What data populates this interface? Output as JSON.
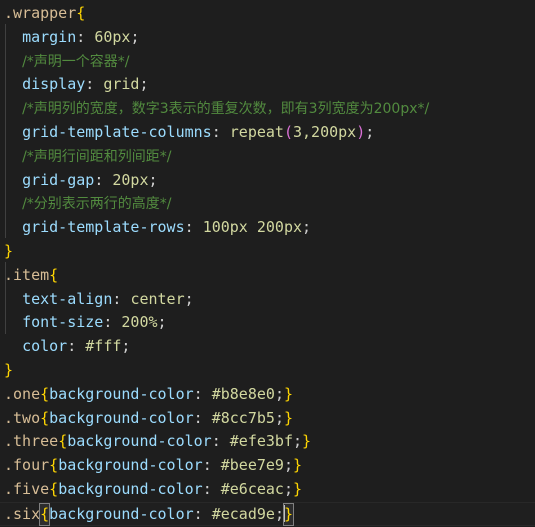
{
  "editor": {
    "theme": "dark-plus",
    "background_color": "#1e1e1e",
    "language": "css",
    "current_line_number": 21,
    "total_lines": 21,
    "colors": {
      "selector": "#d7bd96",
      "brace": "#ffd602",
      "property": "#9cdcfe",
      "value": "#d2d8a0",
      "paren": "#da70d6",
      "comment": "#528b3f",
      "plain": "#d4d4d4",
      "indent_guide": "#404040",
      "bracket_match_outline": "#808080"
    }
  },
  "code": {
    "l1": {
      "selector": ".wrapper",
      "brace": "{"
    },
    "l2": {
      "prop": "margin",
      "punct": ": ",
      "value": "60px",
      "semi": ";"
    },
    "l3": {
      "comment": "/*声明一个容器*/"
    },
    "l4": {
      "prop": "display",
      "punct": ": ",
      "value": "grid",
      "semi": ";"
    },
    "l5": {
      "comment": "/*声明列的宽度，数字3表示的重复次数，即有3列宽度为200px*/"
    },
    "l6": {
      "prop": "grid-template-columns",
      "punct": ": ",
      "func": "repeat",
      "paren_open": "(",
      "args": "3,200px",
      "paren_close": ")",
      "semi": ";"
    },
    "l7": {
      "comment": "/*声明行间距和列间距*/"
    },
    "l8": {
      "prop": "grid-gap",
      "punct": ": ",
      "value": "20px",
      "semi": ";"
    },
    "l9": {
      "comment": "/*分别表示两行的高度*/"
    },
    "l10": {
      "prop": "grid-template-rows",
      "punct": ": ",
      "value": "100px 200px",
      "semi": ";"
    },
    "l11": {
      "brace": "}"
    },
    "l12": {
      "selector": ".item",
      "brace": "{"
    },
    "l13": {
      "prop": "text-align",
      "punct": ": ",
      "value": "center",
      "semi": ";"
    },
    "l14": {
      "prop": "font-size",
      "punct": ": ",
      "value": "200%",
      "semi": ";"
    },
    "l15": {
      "prop": "color",
      "punct": ": ",
      "value": "#fff",
      "semi": ";"
    },
    "l16": {
      "brace": "}"
    },
    "l17": {
      "selector": ".one",
      "open": "{",
      "prop": "background-color",
      "punct": ": ",
      "value": "#b8e8e0",
      "semi": ";",
      "close": "}"
    },
    "l18": {
      "selector": ".two",
      "open": "{",
      "prop": "background-color",
      "punct": ": ",
      "value": "#8cc7b5",
      "semi": ";",
      "close": "}"
    },
    "l19": {
      "selector": ".three",
      "open": "{",
      "prop": "background-color",
      "punct": ": ",
      "value": "#efe3bf",
      "semi": ";",
      "close": "}"
    },
    "l20": {
      "selector": ".four",
      "open": "{",
      "prop": "background-color",
      "punct": ": ",
      "value": "#bee7e9",
      "semi": ";",
      "close": "}"
    },
    "l21": {
      "selector": ".five",
      "open": "{",
      "prop": "background-color",
      "punct": ": ",
      "value": "#e6ceac",
      "semi": ";",
      "close": "}"
    },
    "l22": {
      "selector": ".six",
      "open": "{",
      "prop": "background-color",
      "punct": ": ",
      "value": "#ecad9e",
      "semi": ";",
      "close": "}"
    }
  }
}
